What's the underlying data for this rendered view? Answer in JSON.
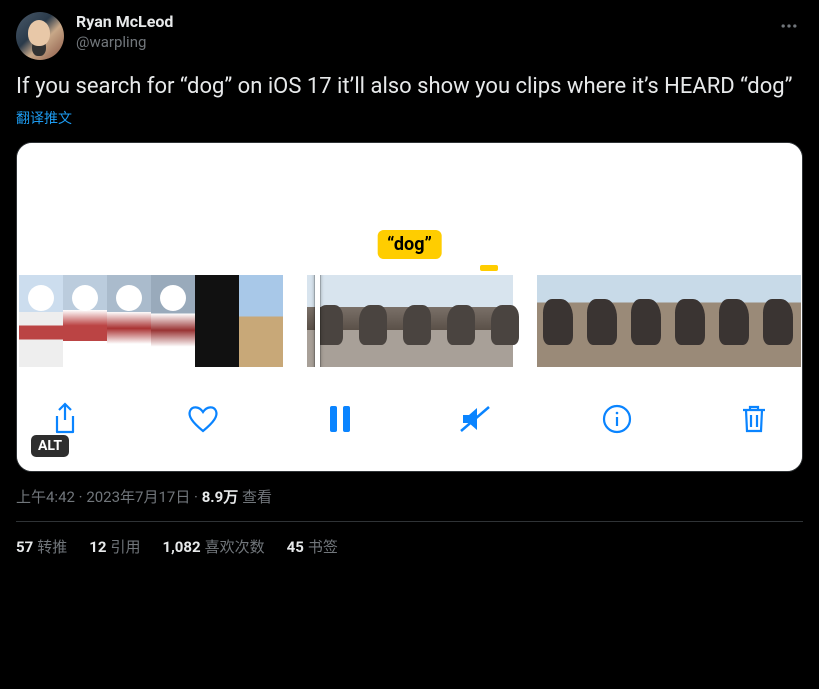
{
  "author": {
    "display_name": "Ryan McLeod",
    "handle": "@warpling"
  },
  "tweet_text": "If you search for “dog” on iOS 17 it’ll also show you clips where it’s HEARD “dog”",
  "translate_label": "翻译推文",
  "media": {
    "tooltip": "“dog”",
    "alt_badge": "ALT",
    "toolbar": {
      "share": "share",
      "like": "like",
      "pause": "pause",
      "mute": "muted",
      "info": "info",
      "trash": "delete"
    }
  },
  "meta": {
    "time": "上午4:42",
    "sep1": " · ",
    "date": "2023年7月17日",
    "sep2": " · ",
    "views_value": "8.9万",
    "views_label": " 查看"
  },
  "stats": {
    "retweets_n": "57",
    "retweets_l": "转推",
    "quotes_n": "12",
    "quotes_l": "引用",
    "likes_n": "1,082",
    "likes_l": "喜欢次数",
    "bookmarks_n": "45",
    "bookmarks_l": "书签"
  }
}
